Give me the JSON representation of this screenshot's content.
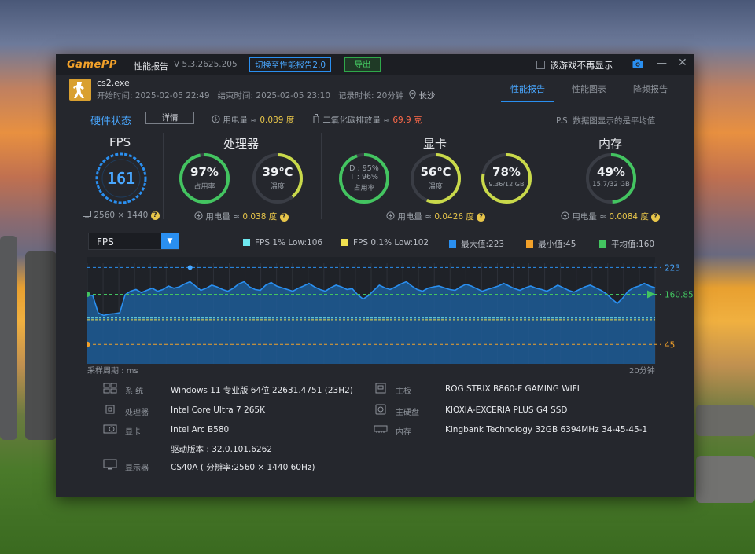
{
  "window": {
    "logo_a": "Game",
    "logo_b": "PP",
    "title": "性能报告",
    "version": "V 5.3.2625.205",
    "switch_button": "切换至性能报告2.0",
    "export_button": "导出",
    "dont_show_label": "该游戏不再显示"
  },
  "session": {
    "exe": "cs2.exe",
    "start": "开始时间: 2025-02-05 22:49",
    "end": "结束时间: 2025-02-05 23:10",
    "duration": "记录时长: 20分钟",
    "location": "长沙"
  },
  "tabs": [
    "性能报告",
    "性能图表",
    "降频报告"
  ],
  "hw": {
    "title": "硬件状态",
    "detail_button": "详情",
    "energy_label": "用电量 ≈",
    "energy_value": "0.089 度",
    "co2_label": "二氧化碳排放量 ≈",
    "co2_value": "69.9 克",
    "ps_note": "P.S. 数据图显示的是平均值"
  },
  "sections": {
    "fps": {
      "title": "FPS",
      "value": "161",
      "resolution": "2560 × 1440"
    },
    "cpu": {
      "title": "处理器",
      "usage": "97%",
      "usage_label": "占用率",
      "temp": "39℃",
      "temp_label": "温度",
      "energy_label": "用电量 ≈",
      "energy_value": "0.038 度"
    },
    "gpu": {
      "title": "显卡",
      "d": "D : 95%",
      "t": "T : 96%",
      "usage_label": "占用率",
      "temp": "56℃",
      "temp_label": "温度",
      "vram": "78%",
      "vram_detail": "9.36/12 GB",
      "energy_label": "用电量 ≈",
      "energy_value": "0.0426 度"
    },
    "mem": {
      "title": "内存",
      "usage": "49%",
      "detail": "15.7/32 GB",
      "energy_label": "用电量 ≈",
      "energy_value": "0.0084 度"
    }
  },
  "gauges": {
    "cpu_usage": 0.97,
    "cpu_temp": 0.39,
    "gpu_usage": 0.95,
    "gpu_temp": 0.56,
    "gpu_vram": 0.78,
    "mem_usage": 0.49
  },
  "metric_select": "FPS",
  "legend": [
    {
      "label": "FPS 1% Low:106",
      "color": "#6ee8f0"
    },
    {
      "label": "FPS 0.1% Low:102",
      "color": "#f0e050"
    },
    {
      "label": "最大值:223",
      "color": "#2a8ff0"
    },
    {
      "label": "最小值:45",
      "color": "#f2a12a"
    },
    {
      "label": "平均值:160",
      "color": "#43c460"
    }
  ],
  "chart_data": {
    "type": "area",
    "title": "",
    "xlabel_left": "采样周期 : ms",
    "xlabel_right": "20分钟",
    "ylim": [
      0,
      240
    ],
    "ref_lines": {
      "max": 223,
      "avg": 160.85,
      "min": 45,
      "low1": 106,
      "low01": 102
    },
    "right_labels": [
      "223",
      "160.85",
      "45"
    ],
    "series": [
      {
        "name": "FPS",
        "values": [
          160,
          158,
          118,
          112,
          115,
          116,
          118,
          160,
          168,
          172,
          165,
          170,
          175,
          168,
          172,
          180,
          175,
          178,
          185,
          190,
          180,
          170,
          175,
          182,
          178,
          172,
          168,
          175,
          185,
          190,
          178,
          172,
          170,
          182,
          188,
          180,
          176,
          172,
          168,
          175,
          180,
          186,
          178,
          172,
          168,
          176,
          182,
          178,
          172,
          174,
          160,
          150,
          158,
          170,
          182,
          176,
          172,
          178,
          185,
          190,
          180,
          172,
          168,
          175,
          178,
          180,
          176,
          172,
          170,
          178,
          184,
          180,
          174,
          168,
          172,
          176,
          180,
          186,
          180,
          174,
          170,
          176,
          180,
          175,
          172,
          168,
          175,
          182,
          176,
          170,
          166,
          172,
          178,
          182,
          176,
          170,
          162,
          150,
          140,
          152,
          168,
          176,
          180,
          186,
          180,
          176
        ]
      }
    ]
  },
  "system": {
    "os_label": "系  统",
    "os": "Windows 11 专业版 64位 22631.4751 (23H2)",
    "cpu_label": "处理器",
    "cpu": "Intel Core Ultra 7 265K",
    "gpu_label": "显卡",
    "gpu": "Intel Arc B580",
    "driver": "驱动版本 : 32.0.101.6262",
    "display_label": "显示器",
    "display": "CS40A ( 分辨率:2560 × 1440 60Hz)",
    "mb_label": "主板",
    "mb": "ROG STRIX B860-F GAMING WIFI",
    "disk_label": "主硬盘",
    "disk": "KIOXIA-EXCERIA PLUS G4 SSD",
    "ram_label": "内存",
    "ram": "Kingbank Technology 32GB 6394MHz 34-45-45-1"
  }
}
